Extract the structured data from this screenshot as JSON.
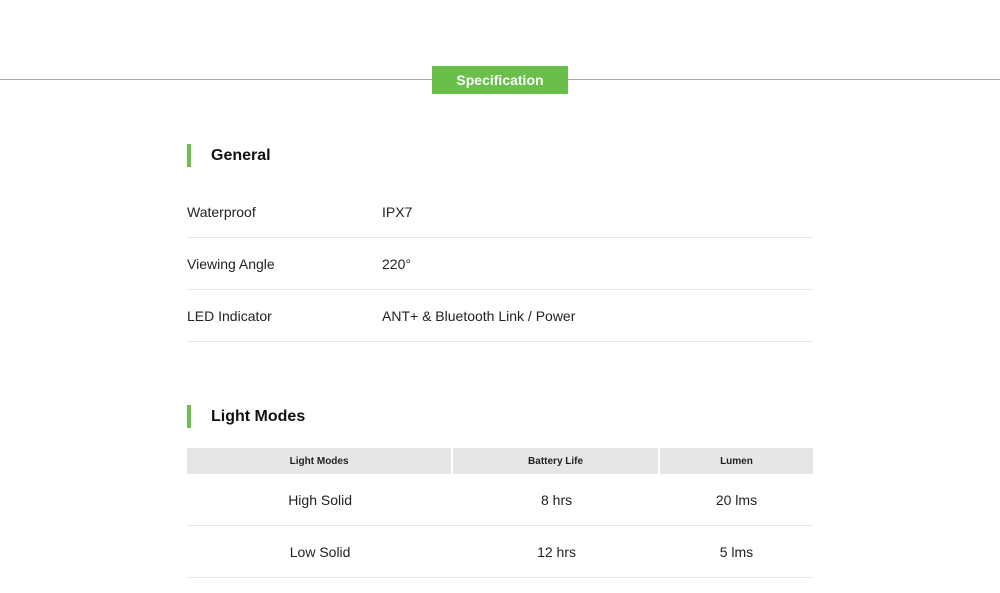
{
  "header": {
    "tab_label": "Specification"
  },
  "general": {
    "title": "General",
    "rows": [
      {
        "label": "Waterproof",
        "value": "IPX7"
      },
      {
        "label": "Viewing Angle",
        "value": "220°"
      },
      {
        "label": "LED Indicator",
        "value": "ANT+ & Bluetooth Link / Power"
      }
    ]
  },
  "light_modes": {
    "title": "Light Modes",
    "columns": [
      "Light Modes",
      "Battery Life",
      "Lumen"
    ],
    "rows": [
      [
        "High Solid",
        "8 hrs",
        "20 lms"
      ],
      [
        "Low Solid",
        "12 hrs",
        "5 lms"
      ]
    ]
  },
  "colors": {
    "accent": "#6abf4b",
    "divider": "#a9a9a9",
    "table_header_bg": "#e6e6e6"
  }
}
